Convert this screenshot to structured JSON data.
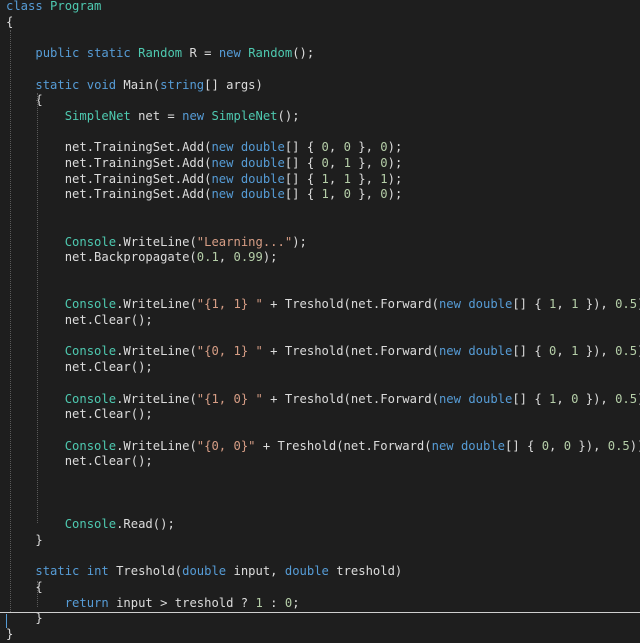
{
  "editor": {
    "language": "C#",
    "lines": [
      [
        {
          "t": "kw",
          "v": "class"
        },
        {
          "t": "pl",
          "v": " "
        },
        {
          "t": "ty",
          "v": "Program"
        }
      ],
      [
        {
          "t": "br",
          "v": "{"
        }
      ],
      [],
      [
        {
          "t": "pl",
          "v": "    "
        },
        {
          "t": "kw",
          "v": "public"
        },
        {
          "t": "pl",
          "v": " "
        },
        {
          "t": "kw",
          "v": "static"
        },
        {
          "t": "pl",
          "v": " "
        },
        {
          "t": "ty",
          "v": "Random"
        },
        {
          "t": "pl",
          "v": " R = "
        },
        {
          "t": "kw",
          "v": "new"
        },
        {
          "t": "pl",
          "v": " "
        },
        {
          "t": "ty",
          "v": "Random"
        },
        {
          "t": "pl",
          "v": "();"
        }
      ],
      [],
      [
        {
          "t": "pl",
          "v": "    "
        },
        {
          "t": "kw",
          "v": "static"
        },
        {
          "t": "pl",
          "v": " "
        },
        {
          "t": "kw",
          "v": "void"
        },
        {
          "t": "pl",
          "v": " Main("
        },
        {
          "t": "kw",
          "v": "string"
        },
        {
          "t": "pl",
          "v": "[] args)"
        }
      ],
      [
        {
          "t": "pl",
          "v": "    {"
        }
      ],
      [
        {
          "t": "pl",
          "v": "        "
        },
        {
          "t": "ty",
          "v": "SimpleNet"
        },
        {
          "t": "pl",
          "v": " net = "
        },
        {
          "t": "kw",
          "v": "new"
        },
        {
          "t": "pl",
          "v": " "
        },
        {
          "t": "ty",
          "v": "SimpleNet"
        },
        {
          "t": "pl",
          "v": "();"
        }
      ],
      [],
      [
        {
          "t": "pl",
          "v": "        net.TrainingSet.Add("
        },
        {
          "t": "kw",
          "v": "new"
        },
        {
          "t": "pl",
          "v": " "
        },
        {
          "t": "kw",
          "v": "double"
        },
        {
          "t": "pl",
          "v": "[] { "
        },
        {
          "t": "nu",
          "v": "0"
        },
        {
          "t": "pl",
          "v": ", "
        },
        {
          "t": "nu",
          "v": "0"
        },
        {
          "t": "pl",
          "v": " }, "
        },
        {
          "t": "nu",
          "v": "0"
        },
        {
          "t": "pl",
          "v": ");"
        }
      ],
      [
        {
          "t": "pl",
          "v": "        net.TrainingSet.Add("
        },
        {
          "t": "kw",
          "v": "new"
        },
        {
          "t": "pl",
          "v": " "
        },
        {
          "t": "kw",
          "v": "double"
        },
        {
          "t": "pl",
          "v": "[] { "
        },
        {
          "t": "nu",
          "v": "0"
        },
        {
          "t": "pl",
          "v": ", "
        },
        {
          "t": "nu",
          "v": "1"
        },
        {
          "t": "pl",
          "v": " }, "
        },
        {
          "t": "nu",
          "v": "0"
        },
        {
          "t": "pl",
          "v": ");"
        }
      ],
      [
        {
          "t": "pl",
          "v": "        net.TrainingSet.Add("
        },
        {
          "t": "kw",
          "v": "new"
        },
        {
          "t": "pl",
          "v": " "
        },
        {
          "t": "kw",
          "v": "double"
        },
        {
          "t": "pl",
          "v": "[] { "
        },
        {
          "t": "nu",
          "v": "1"
        },
        {
          "t": "pl",
          "v": ", "
        },
        {
          "t": "nu",
          "v": "1"
        },
        {
          "t": "pl",
          "v": " }, "
        },
        {
          "t": "nu",
          "v": "1"
        },
        {
          "t": "pl",
          "v": ");"
        }
      ],
      [
        {
          "t": "pl",
          "v": "        net.TrainingSet.Add("
        },
        {
          "t": "kw",
          "v": "new"
        },
        {
          "t": "pl",
          "v": " "
        },
        {
          "t": "kw",
          "v": "double"
        },
        {
          "t": "pl",
          "v": "[] { "
        },
        {
          "t": "nu",
          "v": "1"
        },
        {
          "t": "pl",
          "v": ", "
        },
        {
          "t": "nu",
          "v": "0"
        },
        {
          "t": "pl",
          "v": " }, "
        },
        {
          "t": "nu",
          "v": "0"
        },
        {
          "t": "pl",
          "v": ");"
        }
      ],
      [],
      [],
      [
        {
          "t": "pl",
          "v": "        "
        },
        {
          "t": "ty",
          "v": "Console"
        },
        {
          "t": "pl",
          "v": ".WriteLine("
        },
        {
          "t": "st",
          "v": "\"Learning...\""
        },
        {
          "t": "pl",
          "v": ");"
        }
      ],
      [
        {
          "t": "pl",
          "v": "        net.Backpropagate("
        },
        {
          "t": "nu",
          "v": "0.1"
        },
        {
          "t": "pl",
          "v": ", "
        },
        {
          "t": "nu",
          "v": "0.99"
        },
        {
          "t": "pl",
          "v": ");"
        }
      ],
      [],
      [],
      [
        {
          "t": "pl",
          "v": "        "
        },
        {
          "t": "ty",
          "v": "Console"
        },
        {
          "t": "pl",
          "v": ".WriteLine("
        },
        {
          "t": "st",
          "v": "\"{1, 1} \""
        },
        {
          "t": "pl",
          "v": " + Treshold(net.Forward("
        },
        {
          "t": "kw",
          "v": "new"
        },
        {
          "t": "pl",
          "v": " "
        },
        {
          "t": "kw",
          "v": "double"
        },
        {
          "t": "pl",
          "v": "[] { "
        },
        {
          "t": "nu",
          "v": "1"
        },
        {
          "t": "pl",
          "v": ", "
        },
        {
          "t": "nu",
          "v": "1"
        },
        {
          "t": "pl",
          "v": " }), "
        },
        {
          "t": "nu",
          "v": "0.5"
        },
        {
          "t": "pl",
          "v": "));"
        }
      ],
      [
        {
          "t": "pl",
          "v": "        net.Clear();"
        }
      ],
      [],
      [
        {
          "t": "pl",
          "v": "        "
        },
        {
          "t": "ty",
          "v": "Console"
        },
        {
          "t": "pl",
          "v": ".WriteLine("
        },
        {
          "t": "st",
          "v": "\"{0, 1} \""
        },
        {
          "t": "pl",
          "v": " + Treshold(net.Forward("
        },
        {
          "t": "kw",
          "v": "new"
        },
        {
          "t": "pl",
          "v": " "
        },
        {
          "t": "kw",
          "v": "double"
        },
        {
          "t": "pl",
          "v": "[] { "
        },
        {
          "t": "nu",
          "v": "0"
        },
        {
          "t": "pl",
          "v": ", "
        },
        {
          "t": "nu",
          "v": "1"
        },
        {
          "t": "pl",
          "v": " }), "
        },
        {
          "t": "nu",
          "v": "0.5"
        },
        {
          "t": "pl",
          "v": "));"
        }
      ],
      [
        {
          "t": "pl",
          "v": "        net.Clear();"
        }
      ],
      [],
      [
        {
          "t": "pl",
          "v": "        "
        },
        {
          "t": "ty",
          "v": "Console"
        },
        {
          "t": "pl",
          "v": ".WriteLine("
        },
        {
          "t": "st",
          "v": "\"{1, 0} \""
        },
        {
          "t": "pl",
          "v": " + Treshold(net.Forward("
        },
        {
          "t": "kw",
          "v": "new"
        },
        {
          "t": "pl",
          "v": " "
        },
        {
          "t": "kw",
          "v": "double"
        },
        {
          "t": "pl",
          "v": "[] { "
        },
        {
          "t": "nu",
          "v": "1"
        },
        {
          "t": "pl",
          "v": ", "
        },
        {
          "t": "nu",
          "v": "0"
        },
        {
          "t": "pl",
          "v": " }), "
        },
        {
          "t": "nu",
          "v": "0.5"
        },
        {
          "t": "pl",
          "v": "));"
        }
      ],
      [
        {
          "t": "pl",
          "v": "        net.Clear();"
        }
      ],
      [],
      [
        {
          "t": "pl",
          "v": "        "
        },
        {
          "t": "ty",
          "v": "Console"
        },
        {
          "t": "pl",
          "v": ".WriteLine("
        },
        {
          "t": "st",
          "v": "\"{0, 0}\""
        },
        {
          "t": "pl",
          "v": " + Treshold(net.Forward("
        },
        {
          "t": "kw",
          "v": "new"
        },
        {
          "t": "pl",
          "v": " "
        },
        {
          "t": "kw",
          "v": "double"
        },
        {
          "t": "pl",
          "v": "[] { "
        },
        {
          "t": "nu",
          "v": "0"
        },
        {
          "t": "pl",
          "v": ", "
        },
        {
          "t": "nu",
          "v": "0"
        },
        {
          "t": "pl",
          "v": " }), "
        },
        {
          "t": "nu",
          "v": "0.5"
        },
        {
          "t": "pl",
          "v": "));"
        }
      ],
      [
        {
          "t": "pl",
          "v": "        net.Clear();"
        }
      ],
      [],
      [],
      [],
      [
        {
          "t": "pl",
          "v": "        "
        },
        {
          "t": "ty",
          "v": "Console"
        },
        {
          "t": "pl",
          "v": ".Read();"
        }
      ],
      [
        {
          "t": "pl",
          "v": "    }"
        }
      ],
      [],
      [
        {
          "t": "pl",
          "v": "    "
        },
        {
          "t": "kw",
          "v": "static"
        },
        {
          "t": "pl",
          "v": " "
        },
        {
          "t": "kw",
          "v": "int"
        },
        {
          "t": "pl",
          "v": " Treshold("
        },
        {
          "t": "kw",
          "v": "double"
        },
        {
          "t": "pl",
          "v": " input, "
        },
        {
          "t": "kw",
          "v": "double"
        },
        {
          "t": "pl",
          "v": " treshold)"
        }
      ],
      [
        {
          "t": "pl",
          "v": "    {"
        }
      ],
      [
        {
          "t": "pl",
          "v": "        "
        },
        {
          "t": "kw",
          "v": "return"
        },
        {
          "t": "pl",
          "v": " input > treshold ? "
        },
        {
          "t": "nu",
          "v": "1"
        },
        {
          "t": "pl",
          "v": " : "
        },
        {
          "t": "nu",
          "v": "0"
        },
        {
          "t": "pl",
          "v": ";"
        }
      ],
      [
        {
          "t": "pl",
          "v": "    }"
        }
      ],
      [
        {
          "t": "br",
          "v": "}"
        }
      ]
    ]
  },
  "colors": {
    "background": "#1e1e1e",
    "keyword": "#569cd6",
    "type": "#4ec9b0",
    "string": "#d69d85",
    "number": "#b5cea8",
    "plain": "#dcdcdc"
  }
}
